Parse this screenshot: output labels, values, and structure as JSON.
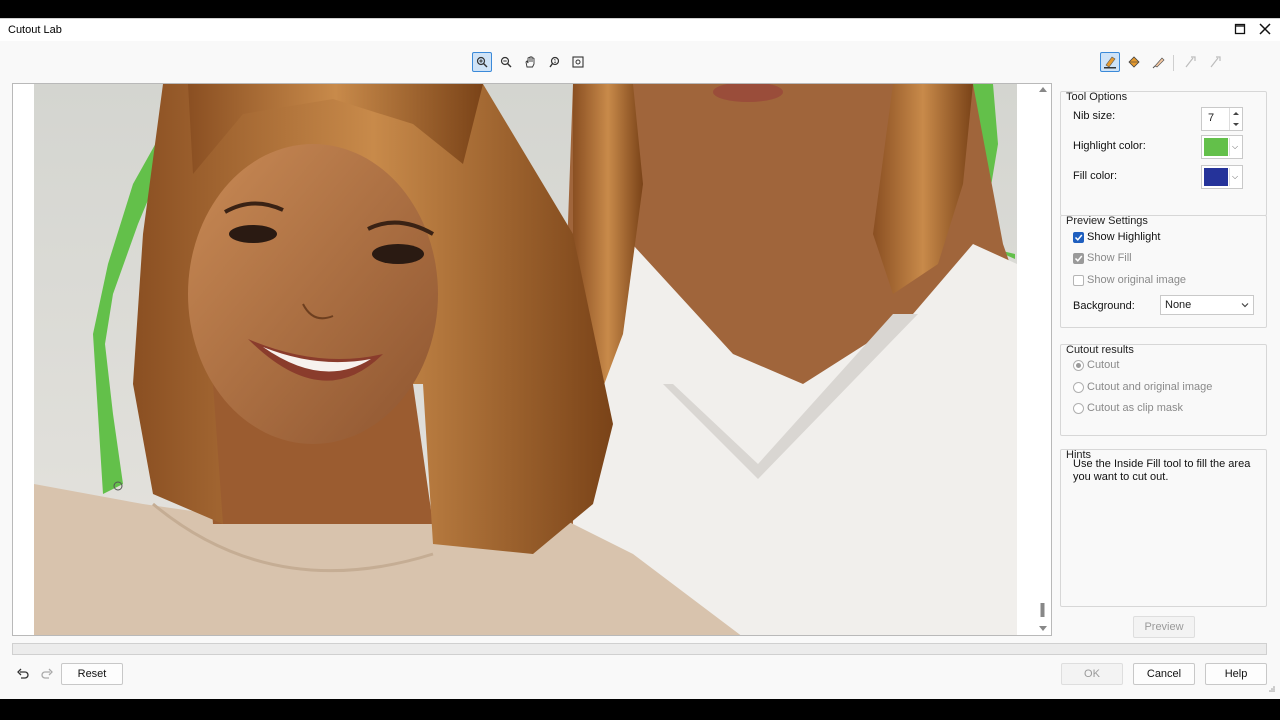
{
  "window": {
    "title": "Cutout Lab"
  },
  "zoom_toolbar": {
    "items": [
      "zoom-in-icon",
      "zoom-out-icon",
      "pan-hand-icon",
      "zoom-actual-icon",
      "zoom-fit-icon"
    ]
  },
  "tools": {
    "items": [
      "highlighter-icon",
      "inside-fill-icon",
      "eraser-icon",
      "smart-highlight-icon",
      "smart-eraser-icon"
    ]
  },
  "tool_options": {
    "title": "Tool Options",
    "nib_label": "Nib size:",
    "nib_value": "7",
    "highlight_label": "Highlight color:",
    "highlight_color": "#63c04a",
    "fill_label": "Fill color:",
    "fill_color": "#25339a"
  },
  "preview_settings": {
    "title": "Preview Settings",
    "show_highlight": "Show Highlight",
    "show_fill": "Show Fill",
    "show_original": "Show original image",
    "background_label": "Background:",
    "background_value": "None"
  },
  "cutout_results": {
    "title": "Cutout results",
    "option_cutout": "Cutout",
    "option_cutout_original": "Cutout and original image",
    "option_clip_mask": "Cutout as clip mask"
  },
  "hints": {
    "title": "Hints",
    "text": "Use the Inside Fill tool to fill the area you want to cut out."
  },
  "buttons": {
    "preview": "Preview",
    "reset": "Reset",
    "ok": "OK",
    "cancel": "Cancel",
    "help": "Help"
  },
  "colors": {
    "accent": "#1f5fbf",
    "highlight_green": "#63c04a"
  }
}
